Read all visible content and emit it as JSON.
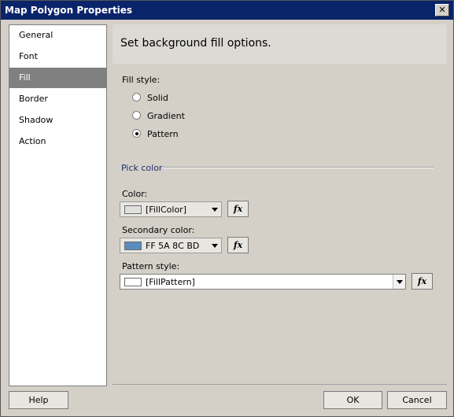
{
  "window": {
    "title": "Map Polygon Properties",
    "close_glyph": "✕"
  },
  "sidebar": {
    "items": [
      {
        "label": "General"
      },
      {
        "label": "Font"
      },
      {
        "label": "Fill"
      },
      {
        "label": "Border"
      },
      {
        "label": "Shadow"
      },
      {
        "label": "Action"
      }
    ]
  },
  "header": {
    "title": "Set background fill options."
  },
  "fill_style": {
    "label": "Fill style:",
    "options": [
      {
        "label": "Solid",
        "selected": false
      },
      {
        "label": "Gradient",
        "selected": false
      },
      {
        "label": "Pattern",
        "selected": true
      }
    ]
  },
  "pick_color": {
    "section_title": "Pick color",
    "color": {
      "label": "Color:",
      "value": "[FillColor]",
      "swatch": "#e0e0e0"
    },
    "secondary_color": {
      "label": "Secondary color:",
      "value": "FF 5A 8C BD",
      "swatch": "#5a8cbd"
    },
    "pattern_style": {
      "label": "Pattern style:",
      "value": "[FillPattern]",
      "swatch": "#ffffff"
    },
    "fx_label": "fx"
  },
  "buttons": {
    "help": "Help",
    "ok": "OK",
    "cancel": "Cancel"
  }
}
